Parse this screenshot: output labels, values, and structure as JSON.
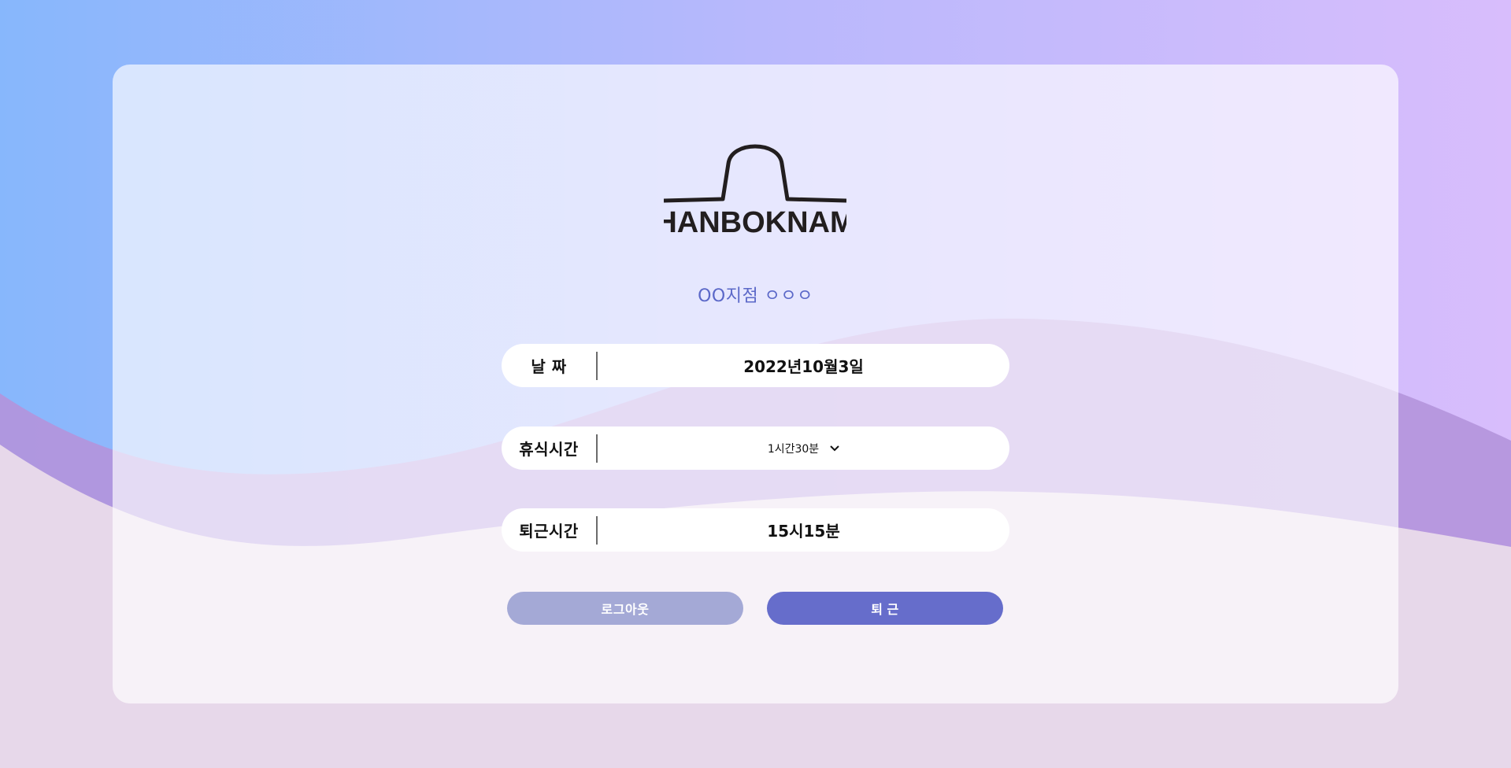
{
  "brand": {
    "name": "HANBOKNAM"
  },
  "branch_label": "OO지점 ㅇㅇㅇ",
  "fields": {
    "date": {
      "label": "날 짜",
      "value": "2022년10월3일"
    },
    "break_time": {
      "label": "휴식시간",
      "selected": "1시간30분"
    },
    "leave_time": {
      "label": "퇴근시간",
      "value": "15시15분"
    }
  },
  "buttons": {
    "logout": "로그아웃",
    "leave": "퇴 근"
  },
  "colors": {
    "accent": "#666dcb",
    "accent_disabled": "#a4a9d6",
    "branch_text": "#5b68c8"
  }
}
